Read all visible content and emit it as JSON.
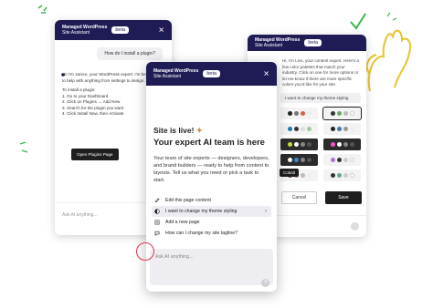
{
  "brand": {
    "name": "Managed WordPress",
    "sub": "Site Assistant",
    "beta": "beta"
  },
  "left": {
    "user_message": "How do I install a plugin?",
    "reply_intro": "Hi! I'm Janice, your WordPress expert. I'm here to help with anything from settings to design.",
    "steps_title": "To install a plugin:",
    "steps": [
      "1. Go to your Dashboard",
      "2. Click on Plugins → Add New",
      "3. Search for the plugin you want",
      "4. Click Install Now, then Activate"
    ],
    "button": "Open Plugins Page",
    "placeholder": "Ask AI anything..."
  },
  "right": {
    "assistant_text": "Hi, I'm Lexi, your content expert. Here's a few color palettes that match your industry. Click on one for more options or let me know if there are more specific colors you'd like for your site.",
    "user_message": "I want to change my theme styling",
    "tooltip": "Cobalt",
    "cancel": "Cancel",
    "save": "Save"
  },
  "center": {
    "headline1": "Site is live!",
    "headline2": "Your expert AI team is here",
    "description": "Your team of site experts — designers, developers, and brand builders — ready to help from content to layouts. Tell us what you need or pick a task to start.",
    "menu": [
      {
        "label": "Edit this page content",
        "icon": "pencil-icon"
      },
      {
        "label": "I want to change my theme styling",
        "icon": "half-circle-icon"
      },
      {
        "label": "Add a new page",
        "icon": "page-add-icon"
      },
      {
        "label": "How can I change my site tagline?",
        "icon": "chat-icon"
      }
    ],
    "placeholder": "Ask AI anything...",
    "send_icon": "question-icon"
  },
  "colors": {
    "header": "#1f1b55",
    "dark_button": "#1e1e1e",
    "cursor_ring": "#e0344c",
    "deco_yellow": "#e8c32a",
    "deco_green": "#3bb54a"
  }
}
